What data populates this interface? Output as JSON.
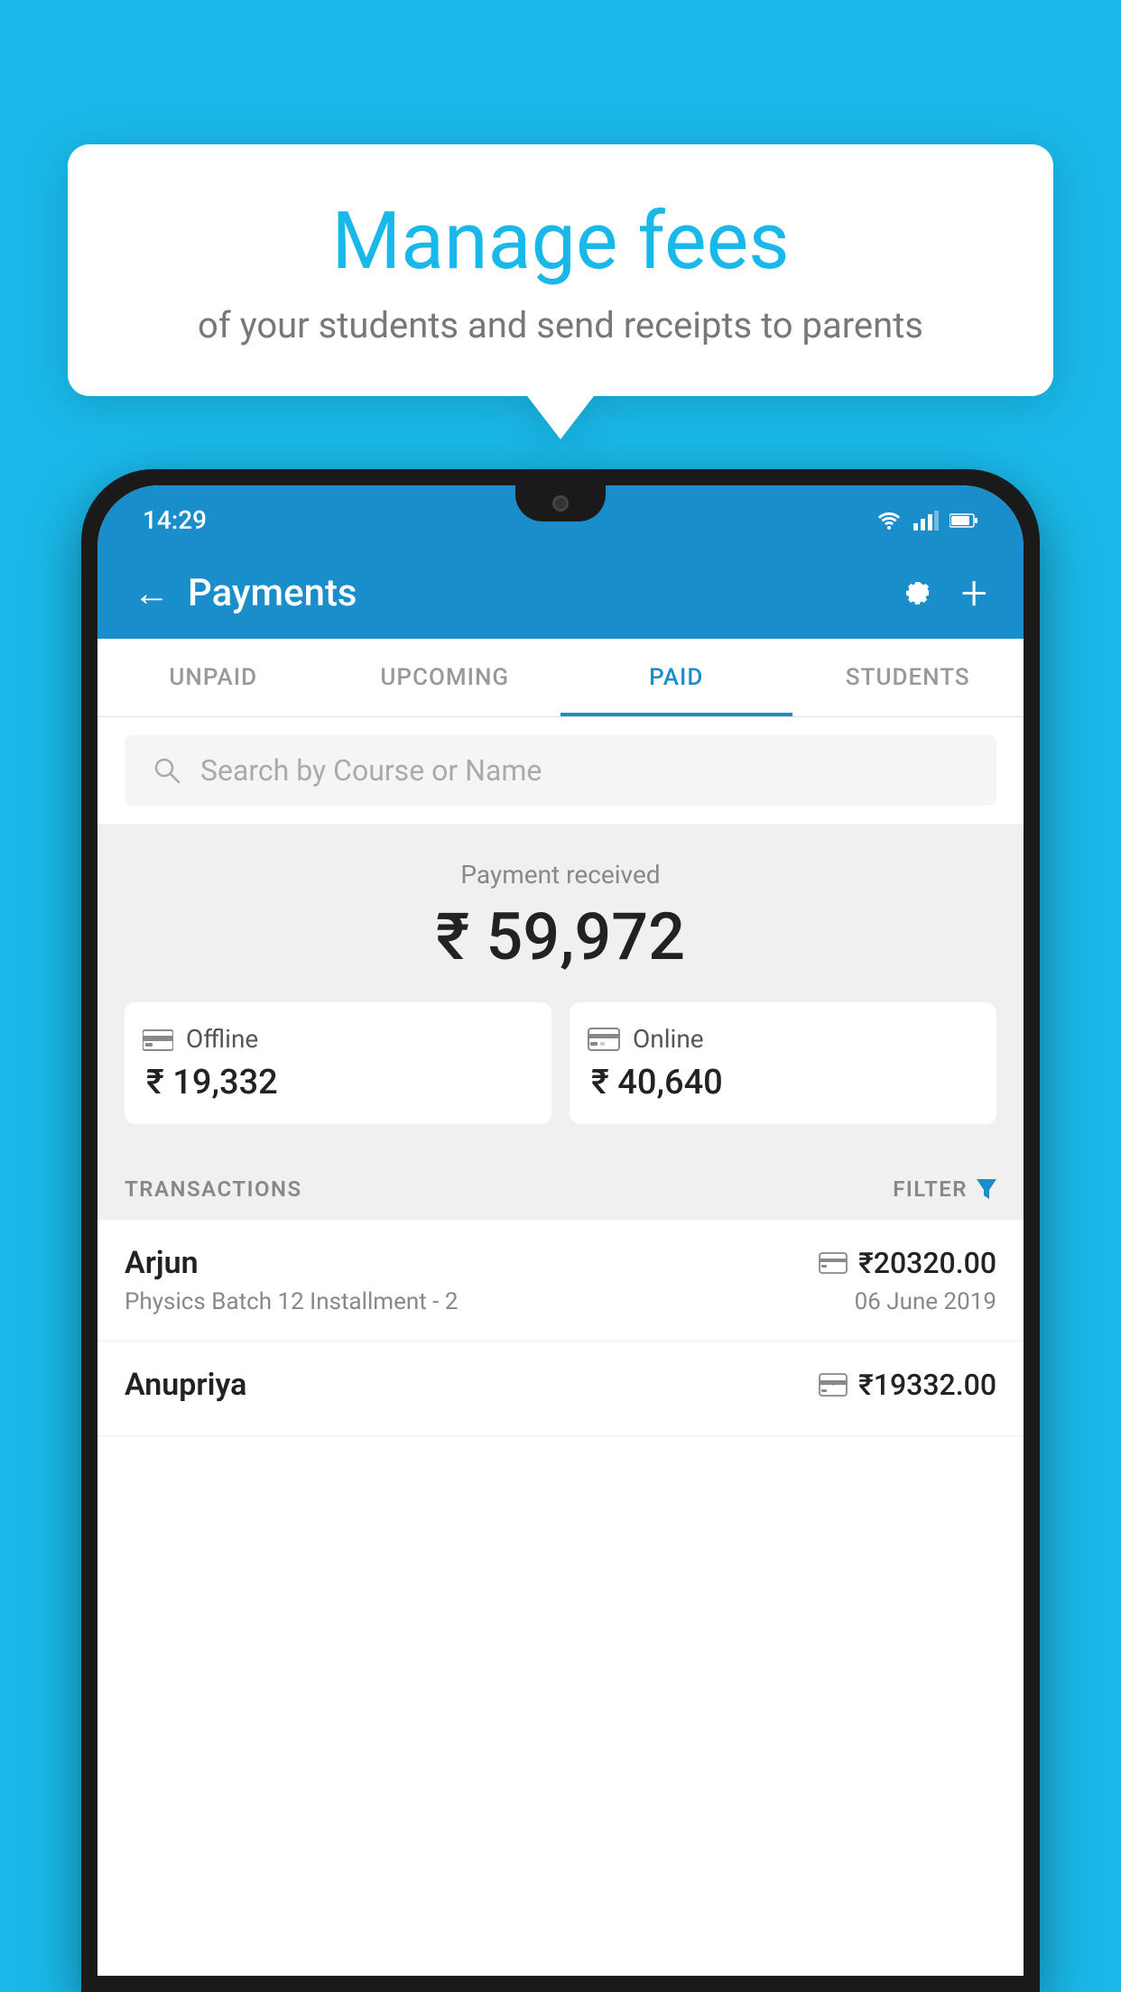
{
  "background_color": "#1ab8e8",
  "bubble": {
    "title": "Manage fees",
    "subtitle": "of your students and send receipts to parents"
  },
  "phone": {
    "status_bar": {
      "time": "14:29",
      "icons": [
        "wifi",
        "signal",
        "battery"
      ]
    },
    "app_bar": {
      "title": "Payments",
      "back_label": "←",
      "settings_label": "⚙",
      "add_label": "+"
    },
    "tabs": [
      {
        "label": "UNPAID",
        "active": false
      },
      {
        "label": "UPCOMING",
        "active": false
      },
      {
        "label": "PAID",
        "active": true
      },
      {
        "label": "STUDENTS",
        "active": false
      }
    ],
    "search": {
      "placeholder": "Search by Course or Name"
    },
    "payment_summary": {
      "received_label": "Payment received",
      "total_amount": "₹ 59,972",
      "offline": {
        "label": "Offline",
        "amount": "₹ 19,332"
      },
      "online": {
        "label": "Online",
        "amount": "₹ 40,640"
      }
    },
    "transactions_section": {
      "header_label": "TRANSACTIONS",
      "filter_label": "FILTER"
    },
    "transactions": [
      {
        "name": "Arjun",
        "course": "Physics Batch 12 Installment - 2",
        "amount": "₹20320.00",
        "date": "06 June 2019",
        "mode": "online"
      },
      {
        "name": "Anupriya",
        "course": "",
        "amount": "₹19332.00",
        "date": "",
        "mode": "offline"
      }
    ]
  }
}
